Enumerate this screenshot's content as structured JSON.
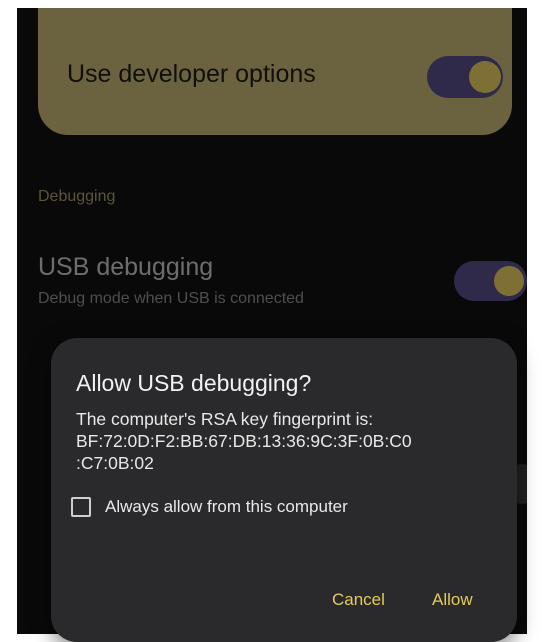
{
  "developer_options": {
    "title": "Use developer options",
    "enabled": true
  },
  "debugging_section": {
    "label": "Debugging",
    "usb_debugging": {
      "title": "USB debugging",
      "subtitle": "Debug mode when USB is connected",
      "enabled": true
    }
  },
  "dialog": {
    "title": "Allow USB debugging?",
    "body_line_1": "The computer's RSA key fingerprint is:",
    "fingerprint_line_1": "BF:72:0D:F2:BB:67:DB:13:36:9C:3F:0B:C0",
    "fingerprint_line_2": ":C7:0B:02",
    "checkbox_label": "Always allow from this computer",
    "checkbox_checked": false,
    "cancel_label": "Cancel",
    "allow_label": "Allow"
  },
  "colors": {
    "card_background": "#c4b475",
    "switch_track": "#574e86",
    "switch_thumb": "#e6cd62",
    "dialog_background": "#2a2a2c",
    "accent": "#e3ca5a"
  }
}
